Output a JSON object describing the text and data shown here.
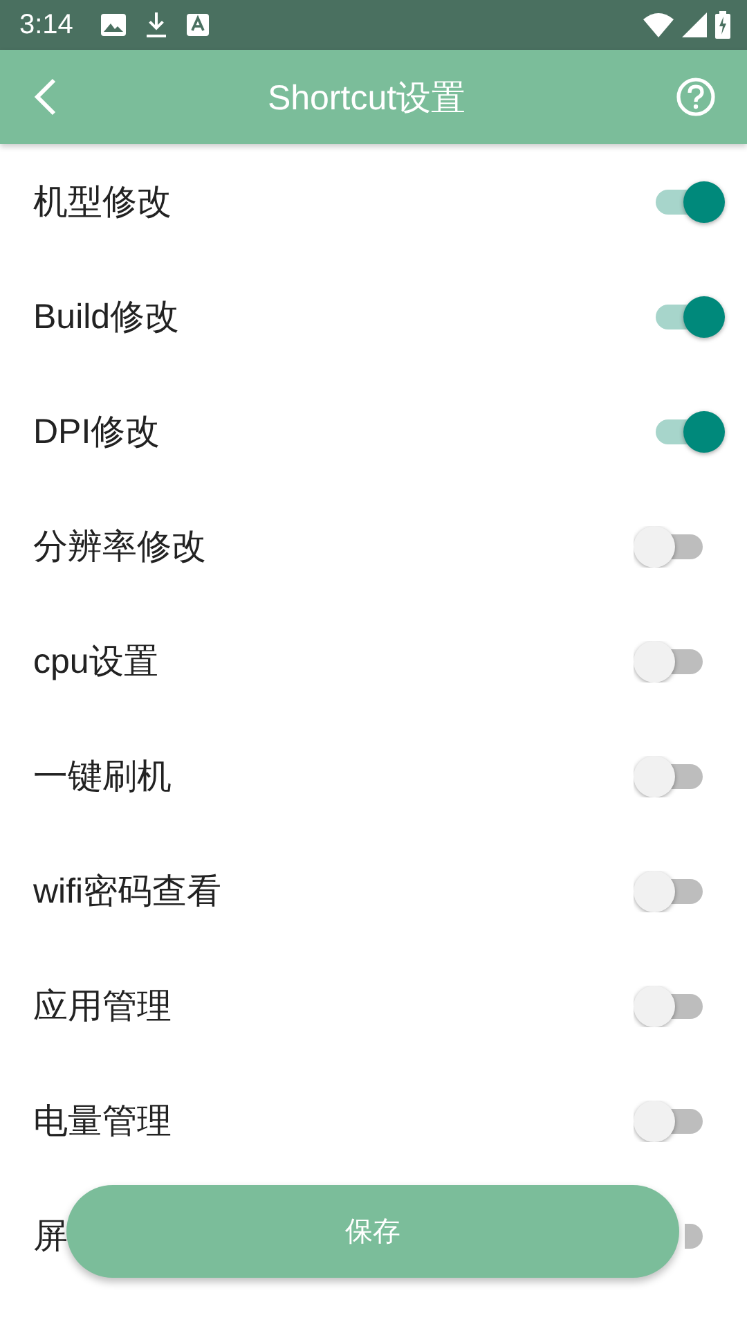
{
  "status_bar": {
    "time": "3:14"
  },
  "app_bar": {
    "title": "Shortcut设置"
  },
  "settings": [
    {
      "label": "机型修改",
      "on": true
    },
    {
      "label": "Build修改",
      "on": true
    },
    {
      "label": "DPI修改",
      "on": true
    },
    {
      "label": "分辨率修改",
      "on": false
    },
    {
      "label": "cpu设置",
      "on": false
    },
    {
      "label": "一键刷机",
      "on": false
    },
    {
      "label": "wifi密码查看",
      "on": false
    },
    {
      "label": "应用管理",
      "on": false
    },
    {
      "label": "电量管理",
      "on": false
    },
    {
      "label": "屏",
      "on": false
    }
  ],
  "save_button": {
    "label": "保存"
  }
}
